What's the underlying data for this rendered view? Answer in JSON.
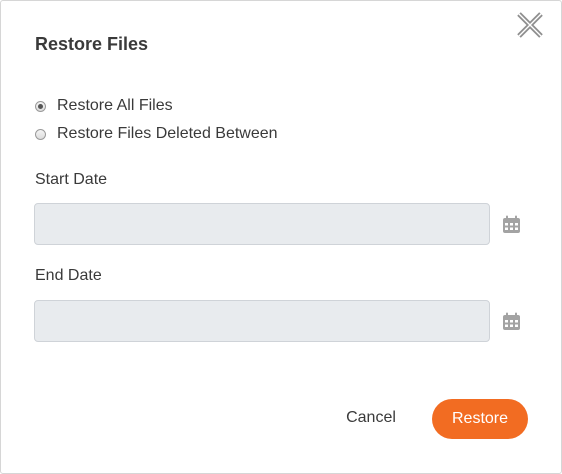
{
  "dialog": {
    "title": "Restore Files",
    "close_icon": "close-x-icon"
  },
  "options": [
    {
      "label": "Restore All Files",
      "checked": true
    },
    {
      "label": "Restore Files Deleted Between",
      "checked": false
    }
  ],
  "start_date": {
    "label": "Start Date",
    "value": "",
    "placeholder": "",
    "icon": "calendar-icon"
  },
  "end_date": {
    "label": "End Date",
    "value": "",
    "placeholder": "",
    "icon": "calendar-icon"
  },
  "buttons": {
    "cancel_label": "Cancel",
    "restore_label": "Restore"
  },
  "colors": {
    "accent": "#f26c22",
    "input_bg": "#e8ebee",
    "icon_gray": "#a3a3a3"
  }
}
